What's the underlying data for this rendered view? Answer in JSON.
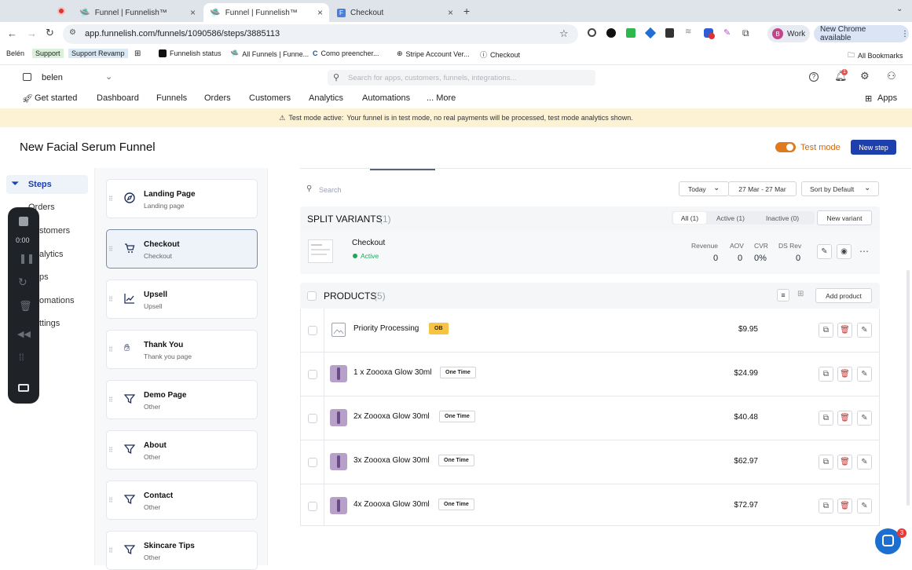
{
  "browser": {
    "tabs": [
      {
        "label": "Funnel | Funnelish™"
      },
      {
        "label": "Funnel | Funnelish™"
      },
      {
        "label": "Checkout"
      }
    ],
    "url": "app.funnelish.com/funnels/1090586/steps/3885113",
    "profile": "Work",
    "profile_initial": "B",
    "new_chrome": "New Chrome available",
    "bookmarks": [
      "Belén",
      "Support",
      "Support Revamp",
      "Funnelish status",
      "All Funnels | Funne...",
      "Como preencher...",
      "Stripe Account Ver...",
      "Checkout"
    ],
    "all_bookmarks": "All Bookmarks"
  },
  "header": {
    "workspace": "belen",
    "search_placeholder": "Search for apps, customers, funnels, integrations...",
    "notif_count": "1"
  },
  "nav": {
    "items": [
      "Get started",
      "Dashboard",
      "Funnels",
      "Orders",
      "Customers",
      "Analytics",
      "Automations",
      "... More"
    ],
    "apps": "Apps"
  },
  "banner": {
    "bold": "Test mode active:",
    "text": "Your funnel is in test mode, no real payments will be processed, test mode analytics shown."
  },
  "page": {
    "title": "New Facial Serum Funnel",
    "test_mode": "Test mode",
    "new_step": "New step"
  },
  "sidebar": {
    "items": [
      "Steps",
      "Orders",
      "Customers",
      "Analytics",
      "Apps",
      "Automations",
      "Settings"
    ],
    "visible": [
      "Steps",
      "Orders",
      "stomers",
      "alytics",
      "ps",
      "omations",
      "ttings"
    ]
  },
  "recorder": {
    "time": "0:00"
  },
  "steps": [
    {
      "name": "Landing Page",
      "type": "Landing page"
    },
    {
      "name": "Checkout",
      "type": "Checkout"
    },
    {
      "name": "Upsell",
      "type": "Upsell"
    },
    {
      "name": "Thank You",
      "type": "Thank you page"
    },
    {
      "name": "Demo Page",
      "type": "Other"
    },
    {
      "name": "About",
      "type": "Other"
    },
    {
      "name": "Contact",
      "type": "Other"
    },
    {
      "name": "Skincare Tips",
      "type": "Other"
    }
  ],
  "filters": {
    "search_placeholder": "Search",
    "period": "Today",
    "range": "27 Mar - 27 Mar",
    "sort": "Sort by Default"
  },
  "variants": {
    "title": "SPLIT VARIANTS",
    "count": "(1)",
    "tabs": [
      "All (1)",
      "Active (1)",
      "Inactive (0)"
    ],
    "new_variant": "New variant",
    "item": {
      "name": "Checkout",
      "status": "Active",
      "metrics": [
        {
          "label": "Revenue",
          "value": "0"
        },
        {
          "label": "AOV",
          "value": "0"
        },
        {
          "label": "CVR",
          "value": "0%"
        },
        {
          "label": "DS Rev",
          "value": "0"
        }
      ]
    }
  },
  "products": {
    "title": "PRODUCTS",
    "count": "(5)",
    "add": "Add product",
    "items": [
      {
        "name": "Priority Processing",
        "tag": "OB",
        "price": "$9.95"
      },
      {
        "name": "1 x Zoooxa Glow 30ml",
        "tag": "One Time",
        "price": "$24.99"
      },
      {
        "name": "2x Zoooxa Glow 30ml",
        "tag": "One Time",
        "price": "$40.48"
      },
      {
        "name": "3x Zoooxa Glow 30ml",
        "tag": "One Time",
        "price": "$62.97"
      },
      {
        "name": "4x Zoooxa Glow 30ml",
        "tag": "One Time",
        "price": "$72.97"
      }
    ]
  },
  "chat": {
    "badge": "3"
  }
}
